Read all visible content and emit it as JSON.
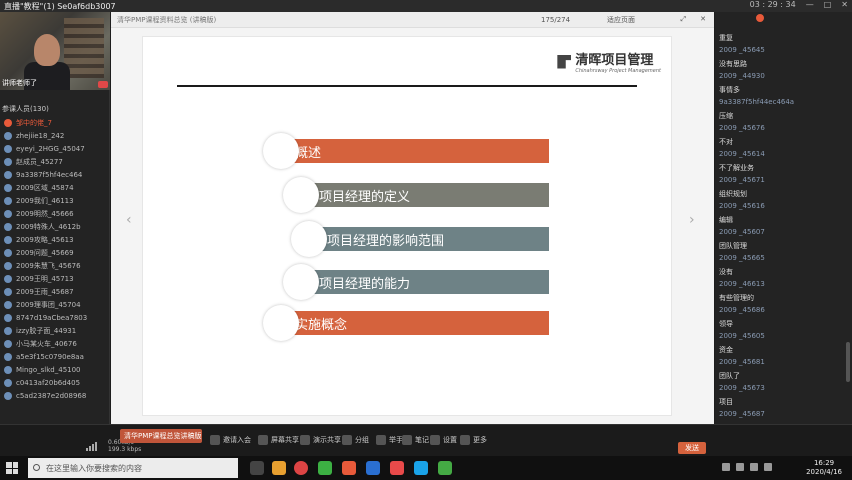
{
  "titlebar": {
    "title": "直播\"教程\"(1)    Se0af6db3007",
    "right_text": "03 : 29 : 34"
  },
  "presenter": {
    "name": "讲师老师了",
    "viewer_count_label": "参课人员(130)"
  },
  "viewers": [
    "邹中的佬_7",
    "zhejiie18_242",
    "eyeyi_2HGG_45047",
    "赵成员_45277",
    "9a3387f5hf4ec464",
    "2009区域_45874",
    "2009我们_46113",
    "2009明然_45666",
    "2009特殊人_4612b",
    "2009攻略_45613",
    "2009问题_45669",
    "2009朱慧飞_45676",
    "2009王明_45713",
    "2009王雨_45687",
    "2009理事团_45704",
    "8747d19aCbea7803",
    "izzy胶子面_44931",
    "小马某火车_40676",
    "a5e3f15c0790e8aa",
    "Mingo_slkd_45100",
    "c0413af20b6d405",
    "c5ad2387e2d08968"
  ],
  "document": {
    "tab_title": "清华PMP课程资料总览 (讲稿版)",
    "page_indicator": "175/274",
    "view_mode": "适应页面",
    "logo_cn": "清晖项目管理",
    "logo_en": "Chinahrsway Project Management",
    "items": [
      "概述",
      "项目经理的定义",
      "项目经理的影响范围",
      "项目经理的能力",
      "实施概念"
    ]
  },
  "chat": [
    {
      "name": "",
      "text": "重复"
    },
    {
      "name": "2009 _45645",
      "text": "没有思路"
    },
    {
      "name": "2009 _44930",
      "text": "事情多"
    },
    {
      "name": "9a3387f5hf44ec464a",
      "text": "压缩"
    },
    {
      "name": "2009 _45676",
      "text": "不对"
    },
    {
      "name": "2009 _45614",
      "text": "不了解业务"
    },
    {
      "name": "2009 _45671",
      "text": "组织规划"
    },
    {
      "name": "2009 _45616",
      "text": "编辑"
    },
    {
      "name": "2009 _45607",
      "text": "团队管理"
    },
    {
      "name": "2009 _45665",
      "text": "没有"
    },
    {
      "name": "2009 _46613",
      "text": "有些管理的"
    },
    {
      "name": "2009 _45686",
      "text": "领导"
    },
    {
      "name": "2009 _45605",
      "text": "资金"
    },
    {
      "name": "2009 _45681",
      "text": "团队了"
    },
    {
      "name": "2009 _45673",
      "text": "项目"
    },
    {
      "name": "2009 _45687",
      "text": "好累 好几个人了"
    }
  ],
  "toolbar": {
    "share_label": "清华PMP课程总览讲稿版",
    "speed_up": "0.60kb/s",
    "speed_down": "199.3 kbps",
    "buttons": [
      "邀请入会",
      "屏幕共享",
      "演示共享",
      "分组",
      "举手",
      "笔记",
      "设置",
      "更多"
    ],
    "send_label": "发送"
  },
  "taskbar": {
    "search_placeholder": "在这里输入你要搜索的内容",
    "time": "16:29",
    "date": "2020/4/16"
  }
}
